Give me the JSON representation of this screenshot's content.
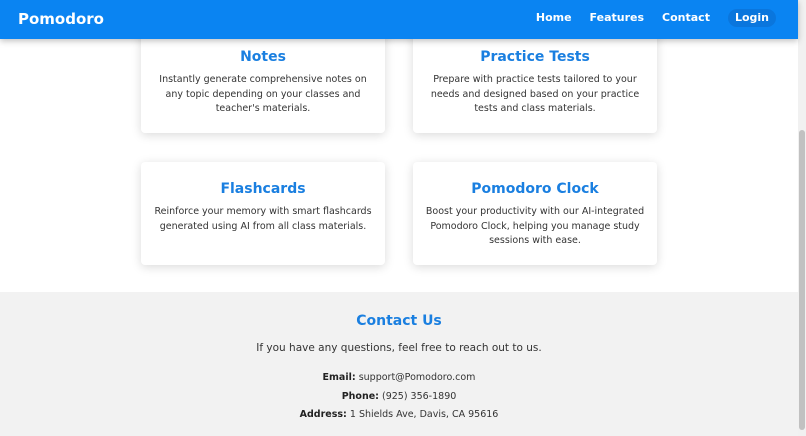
{
  "navbar": {
    "brand": "Pomodoro",
    "links": [
      "Home",
      "Features",
      "Contact",
      "Login"
    ]
  },
  "features": [
    {
      "title": "Notes",
      "description": "Instantly generate comprehensive notes on any topic depending on your classes and teacher's materials."
    },
    {
      "title": "Practice Tests",
      "description": "Prepare with practice tests tailored to your needs and designed based on your practice tests and class materials."
    },
    {
      "title": "Flashcards",
      "description": "Reinforce your memory with smart flashcards generated using AI from all class materials."
    },
    {
      "title": "Pomodoro Clock",
      "description": "Boost your productivity with our AI-integrated Pomodoro Clock, helping you manage study sessions with ease."
    }
  ],
  "contact": {
    "title": "Contact Us",
    "intro": "If you have any questions, feel free to reach out to us.",
    "email_label": "Email:",
    "email": "support@Pomodoro.com",
    "phone_label": "Phone:",
    "phone": "(925) 356-1890",
    "address_label": "Address:",
    "address": "1 Shields Ave, Davis, CA 95616"
  },
  "colors": {
    "navbar": "#0a84f2",
    "accent": "#1a7fe0",
    "footer_bg": "#f2f2f2"
  }
}
